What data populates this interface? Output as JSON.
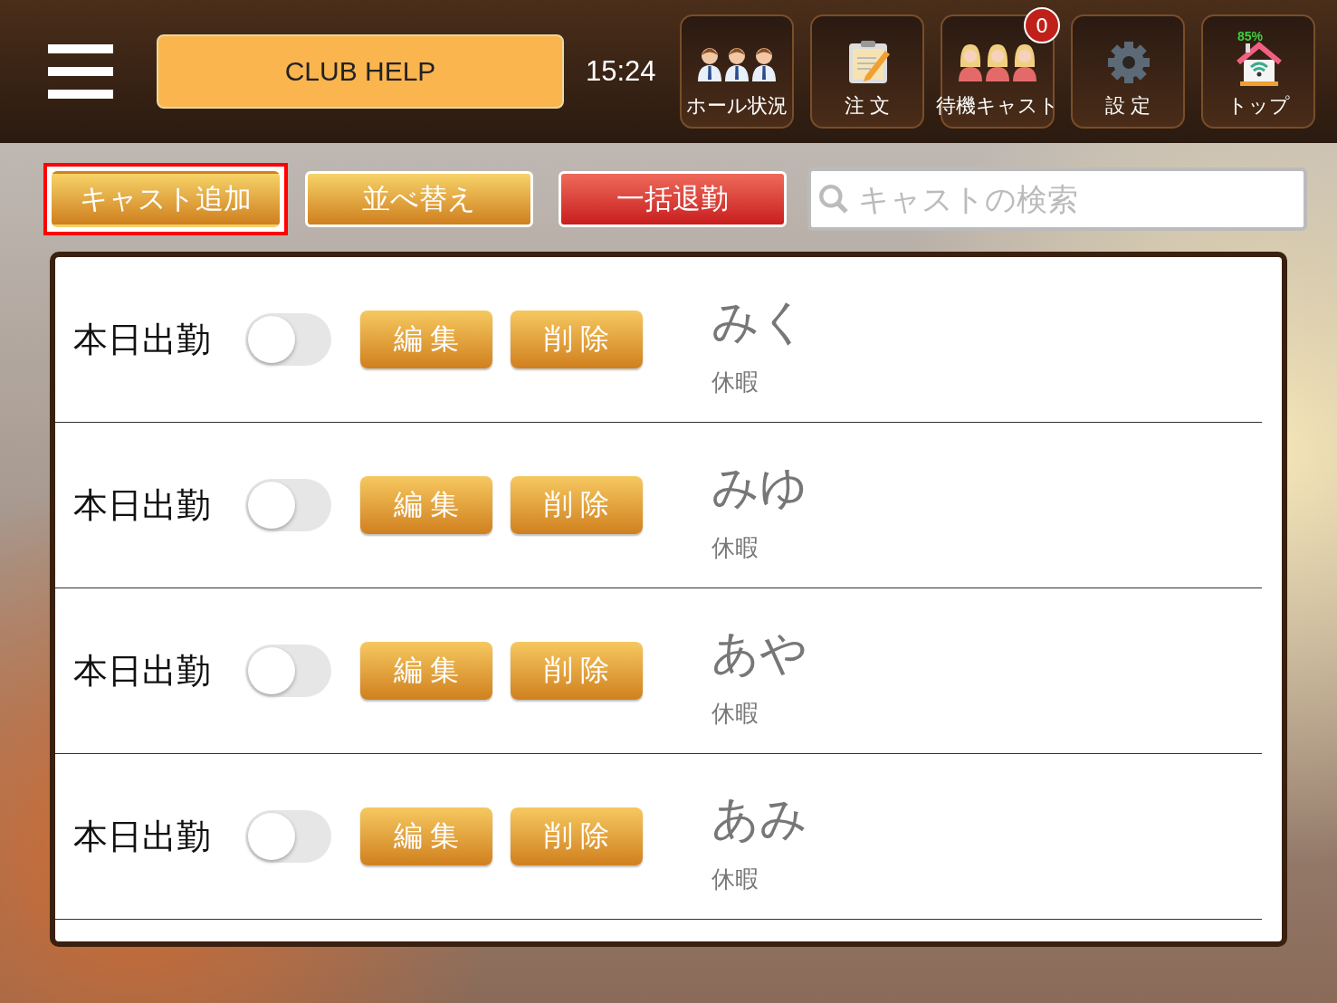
{
  "header": {
    "title_button": "CLUB HELP",
    "time": "15:24",
    "nav": [
      {
        "label": "ホール状況",
        "kind": "staff"
      },
      {
        "label": "注 文",
        "kind": "order"
      },
      {
        "label": "待機キャスト",
        "kind": "cast",
        "badge": "0"
      },
      {
        "label": "設 定",
        "kind": "settings"
      },
      {
        "label": "トップ",
        "kind": "home",
        "battery": "85%"
      }
    ]
  },
  "toolbar": {
    "actions": [
      {
        "label": "キャスト追加",
        "kind": "gold",
        "highlighted": true
      },
      {
        "label": "並べ替え",
        "kind": "gold",
        "highlighted": false
      },
      {
        "label": "一括退勤",
        "kind": "red",
        "highlighted": false
      }
    ],
    "search": {
      "placeholder": "キャストの検索"
    }
  },
  "cast_rows": [
    {
      "attendance_label": "本日出勤",
      "on": false,
      "edit": "編 集",
      "delete": "削 除",
      "name": "みく",
      "status": "休暇"
    },
    {
      "attendance_label": "本日出勤",
      "on": false,
      "edit": "編 集",
      "delete": "削 除",
      "name": "みゆ",
      "status": "休暇"
    },
    {
      "attendance_label": "本日出勤",
      "on": false,
      "edit": "編 集",
      "delete": "削 除",
      "name": "あや",
      "status": "休暇"
    },
    {
      "attendance_label": "本日出勤",
      "on": false,
      "edit": "編 集",
      "delete": "削 除",
      "name": "あみ",
      "status": "休暇"
    }
  ]
}
